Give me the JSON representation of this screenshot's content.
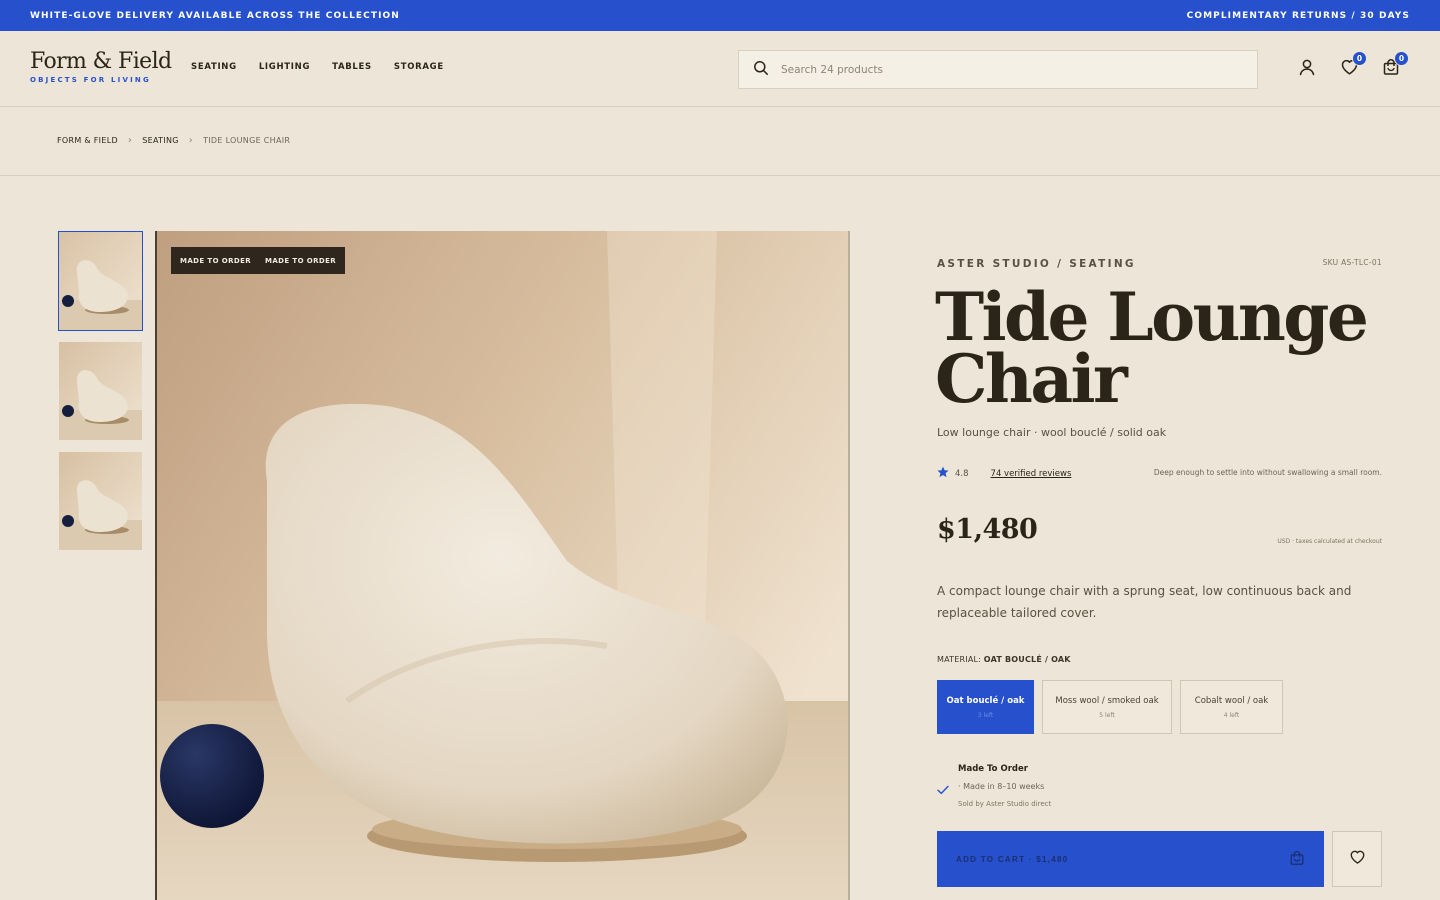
{
  "promo": {
    "left": "WHITE-GLOVE DELIVERY AVAILABLE ACROSS THE COLLECTION",
    "right": "COMPLIMENTARY RETURNS / 30 DAYS"
  },
  "header": {
    "logo_name": "Form & Field",
    "logo_tagline": "OBJECTS FOR LIVING",
    "nav": [
      "SEATING",
      "LIGHTING",
      "TABLES",
      "STORAGE"
    ],
    "search_placeholder": "Search 24 products",
    "wishlist_count": "0",
    "cart_count": "0",
    "icons": [
      "search-icon",
      "account-icon",
      "heart-icon",
      "bag-icon"
    ]
  },
  "breadcrumb": [
    "FORM & FIELD",
    "SEATING",
    "TIDE LOUNGE CHAIR"
  ],
  "gallery": {
    "badges": [
      "MADE TO ORDER",
      "MADE TO ORDER"
    ]
  },
  "product": {
    "brandline": "ASTER STUDIO / SEATING",
    "sku": "SKU AS-TLC-01",
    "title_line1": "Tide Lounge",
    "title_line2": "Chair",
    "subtitle": "Low lounge chair · wool bouclé / solid oak",
    "rating": "4.8",
    "reviews": "74 verified reviews",
    "tagline": "Deep enough to settle into without swallowing a small room.",
    "price": "$1,480",
    "tax_note": "USD · taxes calculated at checkout",
    "description": "A compact lounge chair with a sprung seat, low continuous back and replaceable tailored cover.",
    "material_label": "MATERIAL:",
    "material_value": "OAT BOUCLÉ / OAK",
    "options": [
      {
        "name": "Oat bouclé / oak",
        "stock": "3 left",
        "selected": true
      },
      {
        "name": "Moss wool / smoked oak",
        "stock": "5 left",
        "selected": false
      },
      {
        "name": "Cobalt wool / oak",
        "stock": "4 left",
        "selected": false
      }
    ],
    "availability_title": "Made To Order",
    "availability_weeks": "· Made in 8–10 weeks",
    "sold_by": "Sold by Aster Studio direct",
    "cart_label": "ADD TO CART · $1,480"
  },
  "colors": {
    "accent": "#2650cc",
    "background": "#ede5d7",
    "ink": "#2b2419"
  }
}
